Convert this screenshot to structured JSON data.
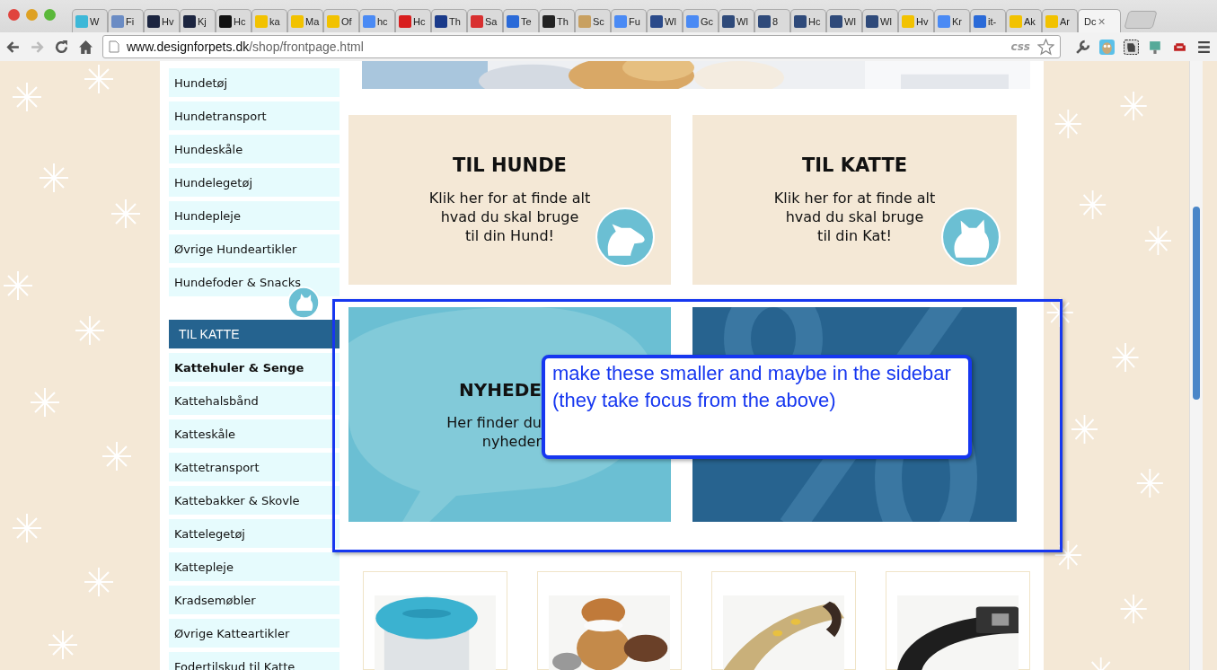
{
  "browser": {
    "tabs": [
      {
        "label": "W",
        "selected": false,
        "color": "#3db8d8"
      },
      {
        "label": "Fi",
        "selected": false,
        "color": "#6b8cc4"
      },
      {
        "label": "Hv",
        "selected": false,
        "color": "#1c2540"
      },
      {
        "label": "Kj",
        "selected": false,
        "color": "#1c2540"
      },
      {
        "label": "Hc",
        "selected": false,
        "color": "#111111"
      },
      {
        "label": "ka",
        "selected": false,
        "color": "#f2c200"
      },
      {
        "label": "Ma",
        "selected": false,
        "color": "#f2c200"
      },
      {
        "label": "Of",
        "selected": false,
        "color": "#f2c200"
      },
      {
        "label": "hc",
        "selected": false,
        "color": "#4a8af4"
      },
      {
        "label": "Hc",
        "selected": false,
        "color": "#d81e1e"
      },
      {
        "label": "Th",
        "selected": false,
        "color": "#1a3a8a"
      },
      {
        "label": "Sa",
        "selected": false,
        "color": "#d83030"
      },
      {
        "label": "Te",
        "selected": false,
        "color": "#2a6ad8"
      },
      {
        "label": "Th",
        "selected": false,
        "color": "#222222"
      },
      {
        "label": "Sc",
        "selected": false,
        "color": "#c8a060"
      },
      {
        "label": "Fu",
        "selected": false,
        "color": "#4a8af4"
      },
      {
        "label": "Wl",
        "selected": false,
        "color": "#2a4a8a"
      },
      {
        "label": "Gc",
        "selected": false,
        "color": "#4a8af4"
      },
      {
        "label": "Wl",
        "selected": false,
        "color": "#2f4a7a"
      },
      {
        "label": "8",
        "selected": false,
        "color": "#2f4a7a"
      },
      {
        "label": "Hc",
        "selected": false,
        "color": "#2f4a7a"
      },
      {
        "label": "Wl",
        "selected": false,
        "color": "#2f4a7a"
      },
      {
        "label": "Wl",
        "selected": false,
        "color": "#2f4a7a"
      },
      {
        "label": "Hv",
        "selected": false,
        "color": "#f2c200"
      },
      {
        "label": "Kr",
        "selected": false,
        "color": "#4a8af4"
      },
      {
        "label": "it-",
        "selected": false,
        "color": "#2a6ad8"
      },
      {
        "label": "Ak",
        "selected": false,
        "color": "#f2c200"
      },
      {
        "label": "Ar",
        "selected": false,
        "color": "#f2c200"
      },
      {
        "label": "Dc",
        "selected": true,
        "close": "×"
      }
    ],
    "address": {
      "host": "www.designforpets.dk",
      "path": "/shop/frontpage.html",
      "badge": "css"
    }
  },
  "sidebar": {
    "dog_items": [
      {
        "label": "Hundetøj",
        "selected": false
      },
      {
        "label": "Hundetransport",
        "selected": false
      },
      {
        "label": "Hundeskåle",
        "selected": false
      },
      {
        "label": "Hundelegetøj",
        "selected": false
      },
      {
        "label": "Hundepleje",
        "selected": false
      },
      {
        "label": "Øvrige Hundeartikler",
        "selected": false
      },
      {
        "label": "Hundefoder & Snacks",
        "selected": false
      }
    ],
    "cat_heading": "TIL KATTE",
    "cat_items": [
      {
        "label": "Kattehuler & Senge",
        "selected": true
      },
      {
        "label": "Kattehalsbånd",
        "selected": false
      },
      {
        "label": "Katteskåle",
        "selected": false
      },
      {
        "label": "Kattetransport",
        "selected": false
      },
      {
        "label": "Kattebakker & Skovle",
        "selected": false
      },
      {
        "label": "Kattelegetøj",
        "selected": false
      },
      {
        "label": "Kattepleje",
        "selected": false
      },
      {
        "label": "Kradsemøbler",
        "selected": false
      },
      {
        "label": "Øvrige Katteartikler",
        "selected": false
      },
      {
        "label": "Fodertilskud til Katte",
        "selected": false
      }
    ]
  },
  "category_tiles": [
    {
      "kind": "dog",
      "title": "TIL HUNDE",
      "text": "Klik her for at finde alt\nhvad du skal bruge\ntil din Hund!"
    },
    {
      "kind": "cat",
      "title": "TIL KATTE",
      "text": "Klik her for at finde alt\nhvad du skal bruge\ntil din Kat!"
    }
  ],
  "promo_tiles": [
    {
      "kind": "news",
      "title": "NYHEDE",
      "text": "Her finder du\nnyheder"
    },
    {
      "kind": "sale"
    }
  ],
  "annotation": {
    "text": "make these smaller and maybe in the sidebar (they take focus from the above)"
  }
}
